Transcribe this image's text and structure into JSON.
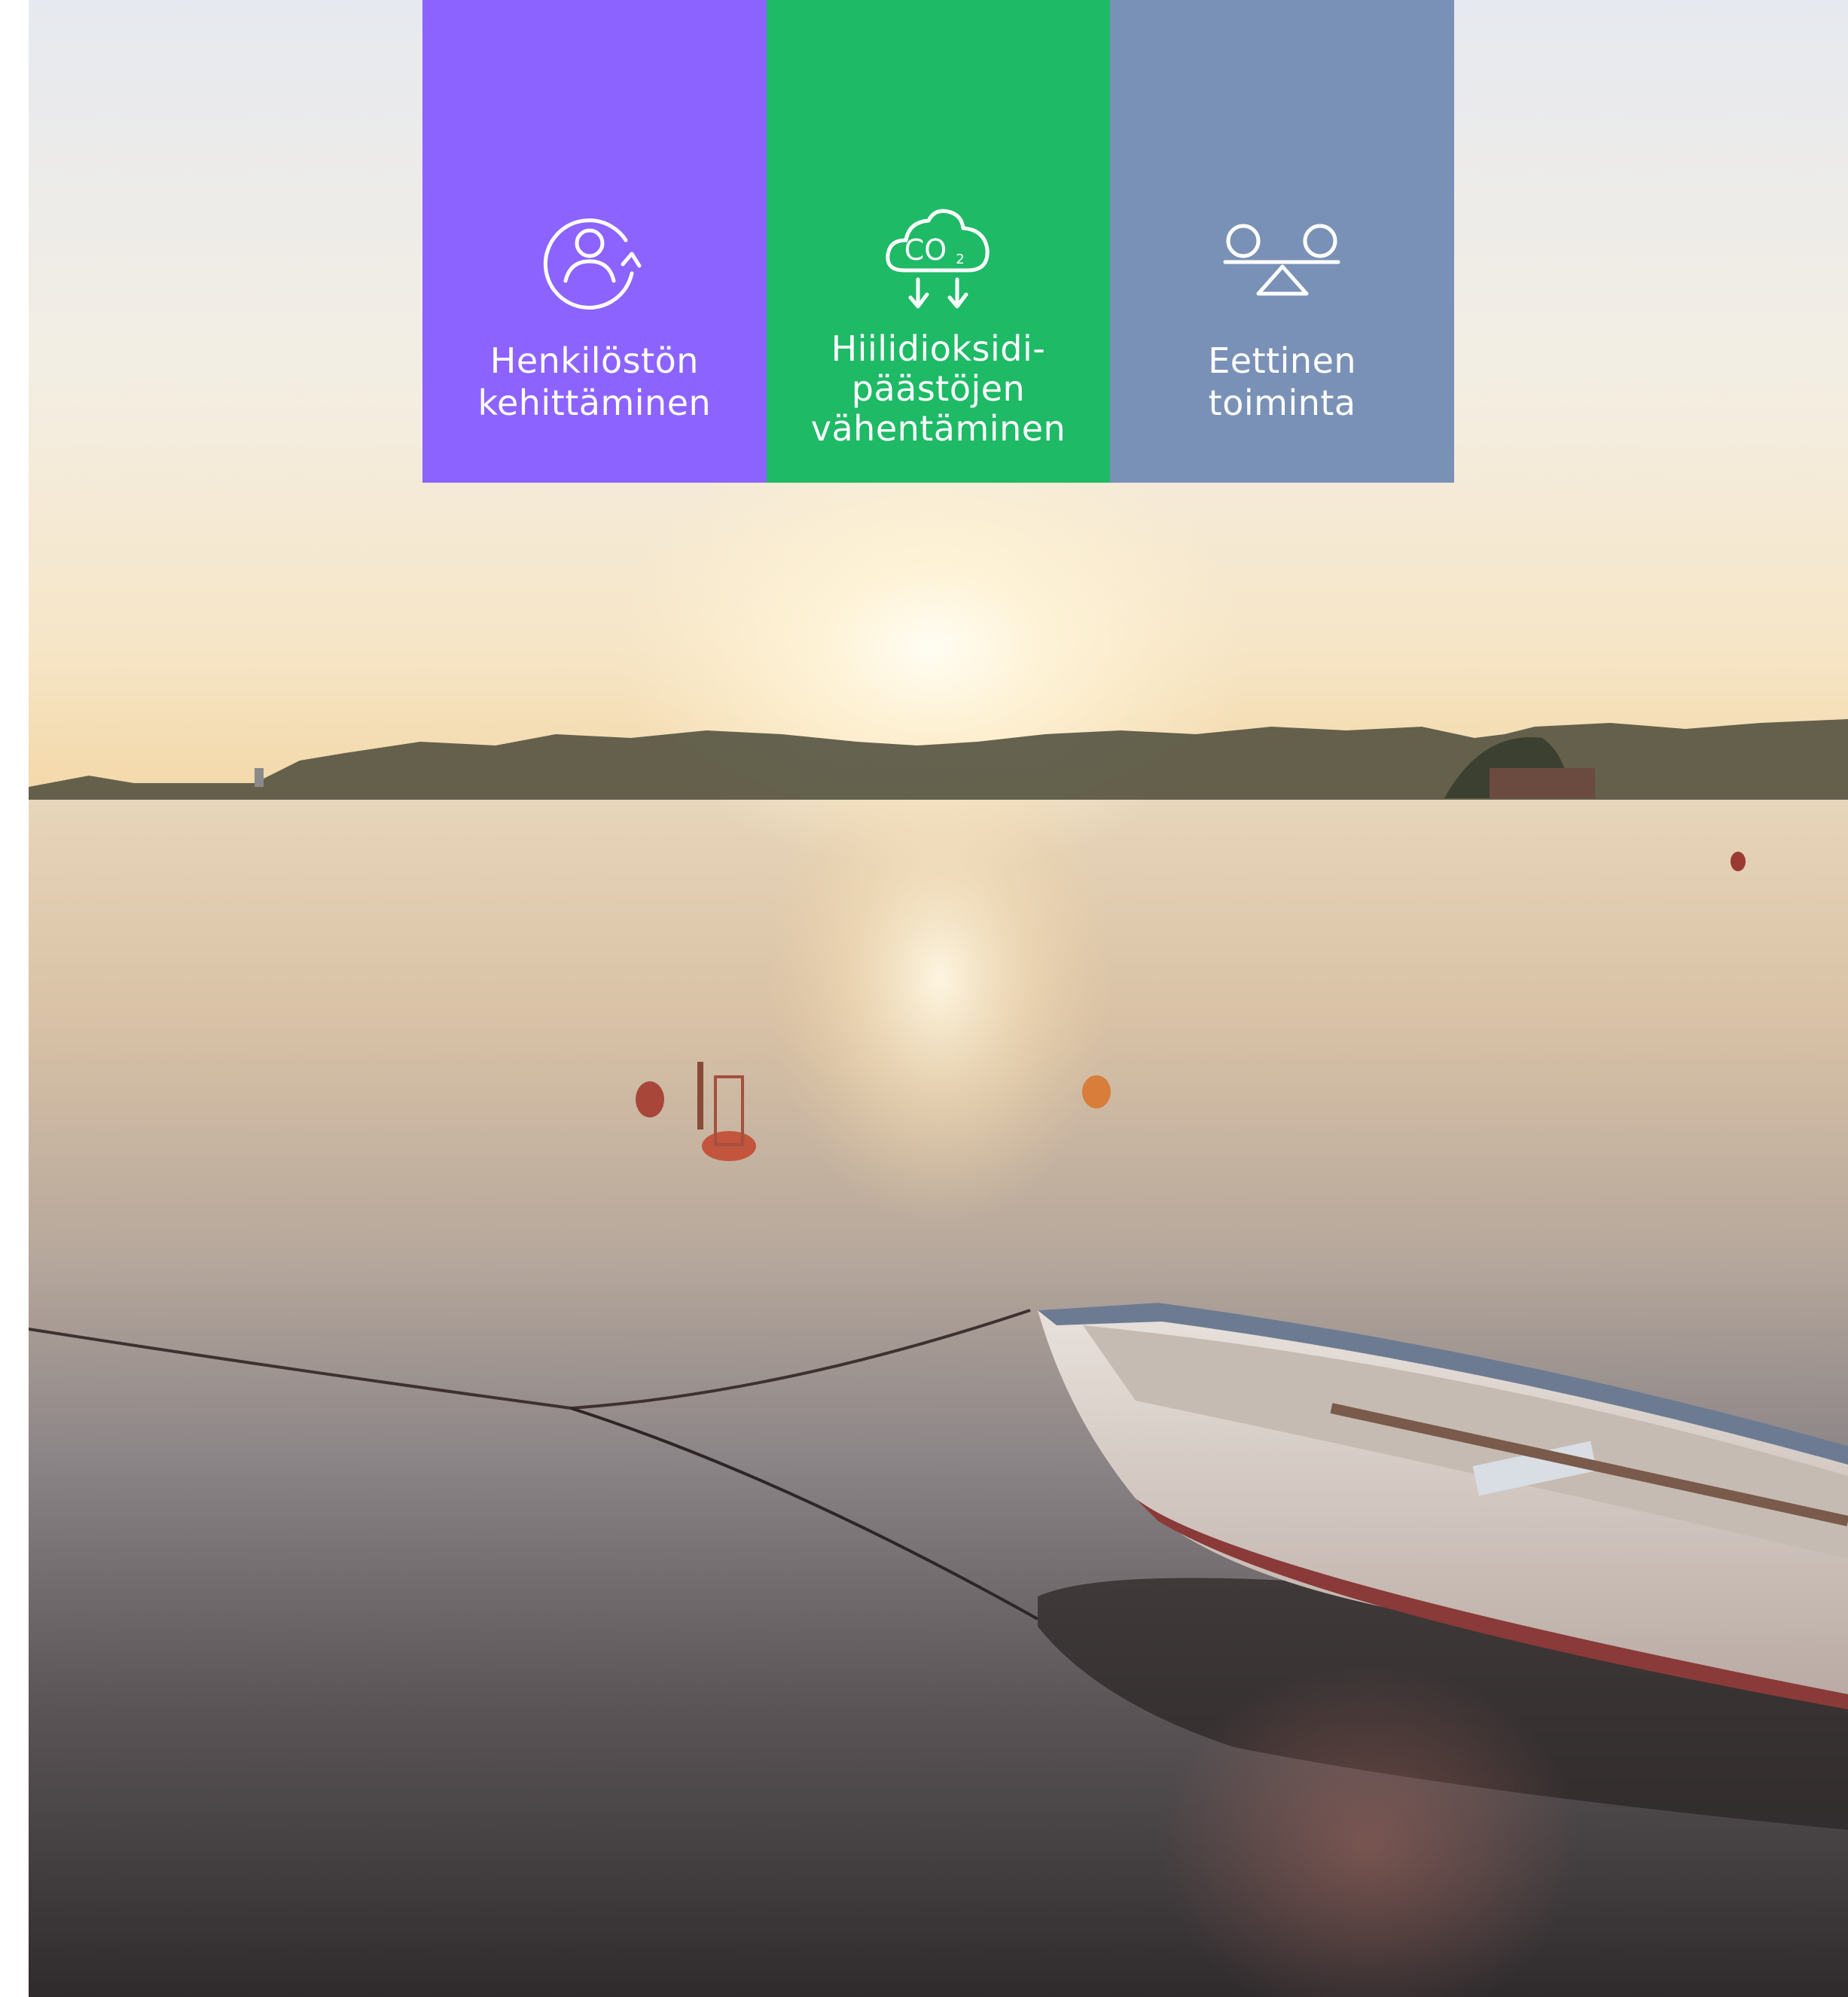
{
  "colors": {
    "people": "#8C63FF",
    "co2": "#1EBA66",
    "ethics": "#7A91B7"
  },
  "tiles": [
    {
      "icon": "person-cycle-icon",
      "label_lines": [
        "Henkilöstön",
        "kehittäminen"
      ]
    },
    {
      "icon": "co2-cloud-reduction-icon",
      "icon_text": "CO",
      "icon_subscript": "2",
      "label_lines": [
        "Hiilidioksidi-",
        "päästöjen",
        "vähentäminen"
      ]
    },
    {
      "icon": "balance-seesaw-icon",
      "label_lines": [
        "Eettinen",
        "toiminta"
      ]
    }
  ],
  "background": {
    "scene": "sunset-lake-with-rowboat-image"
  }
}
